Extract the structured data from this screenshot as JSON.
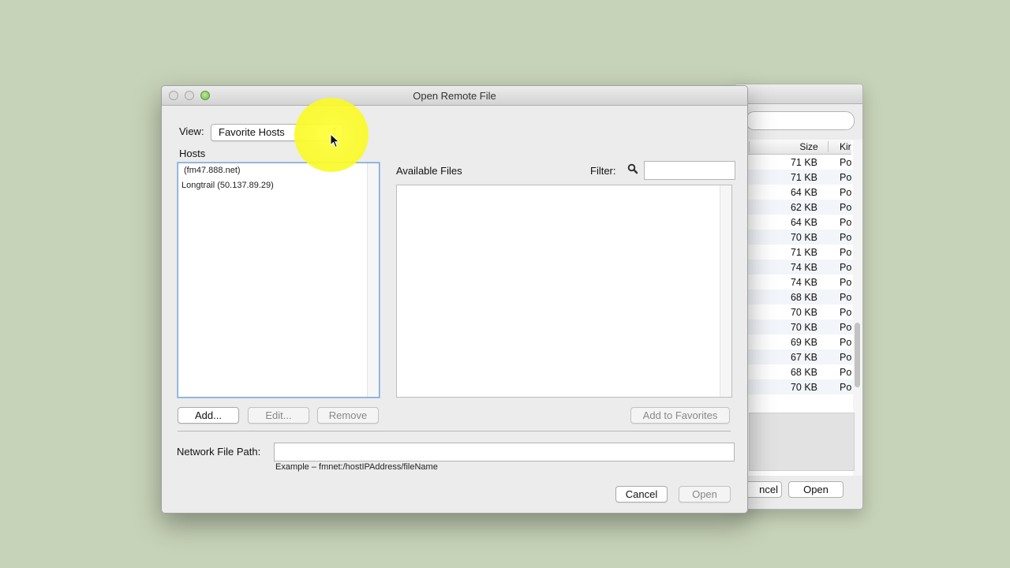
{
  "background_window": {
    "columns": {
      "size": "Size",
      "kind": "Kir"
    },
    "rows": [
      {
        "size": "71 KB",
        "kind": "Po"
      },
      {
        "size": "71 KB",
        "kind": "Po"
      },
      {
        "size": "64 KB",
        "kind": "Po"
      },
      {
        "size": "62 KB",
        "kind": "Po"
      },
      {
        "size": "64 KB",
        "kind": "Po"
      },
      {
        "size": "70 KB",
        "kind": "Po"
      },
      {
        "size": "71 KB",
        "kind": "Po"
      },
      {
        "size": "74 KB",
        "kind": "Po"
      },
      {
        "size": "74 KB",
        "kind": "Po"
      },
      {
        "size": "68 KB",
        "kind": "Po"
      },
      {
        "size": "70 KB",
        "kind": "Po"
      },
      {
        "size": "70 KB",
        "kind": "Po"
      },
      {
        "size": "69 KB",
        "kind": "Po"
      },
      {
        "size": "67 KB",
        "kind": "Po"
      },
      {
        "size": "68 KB",
        "kind": "Po"
      },
      {
        "size": "70 KB",
        "kind": "Po"
      }
    ],
    "cancel_label": "ncel",
    "open_label": "Open"
  },
  "dialog": {
    "title": "Open Remote File",
    "view_label": "View:",
    "view_value": "Favorite Hosts",
    "hosts_label": "Hosts",
    "hosts": [
      "(fm47.888.net)",
      "Longtrail (50.137.89.29)"
    ],
    "available_files_label": "Available Files",
    "filter_label": "Filter:",
    "filter_value": "",
    "buttons": {
      "add": "Add...",
      "edit": "Edit...",
      "remove": "Remove",
      "add_to_favorites": "Add to Favorites",
      "cancel": "Cancel",
      "open": "Open"
    },
    "network_file_path_label": "Network File Path:",
    "network_file_path_value": "",
    "example_text": "Example – fmnet:/hostIPAddress/fileName"
  },
  "icons": {
    "search": "search-icon",
    "popup_arrows": "updown-arrows-icon",
    "cursor": "mouse-pointer-icon"
  },
  "colors": {
    "desktop": "#c7d3b8",
    "highlight": "#f8f82a",
    "focus_ring": "#7aa6d6"
  }
}
